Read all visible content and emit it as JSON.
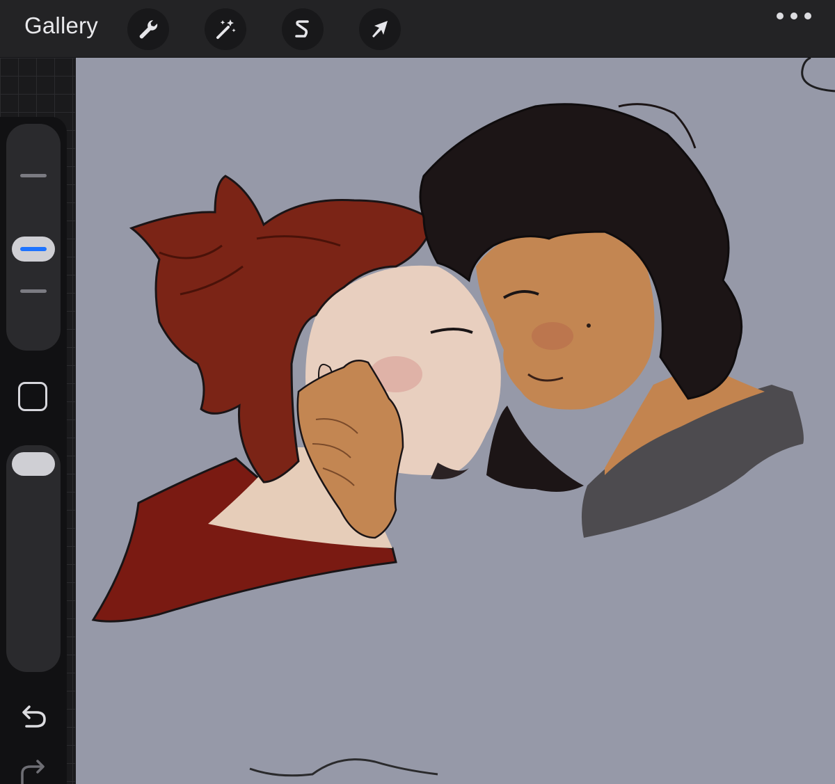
{
  "toolbar": {
    "gallery_label": "Gallery",
    "tools": [
      {
        "name": "wrench-icon",
        "role": "actions"
      },
      {
        "name": "magic-wand-icon",
        "role": "adjustments"
      },
      {
        "name": "selection-s-icon",
        "role": "selection"
      },
      {
        "name": "arrow-cursor-icon",
        "role": "transform"
      }
    ],
    "more_icon": "ellipsis-icon"
  },
  "sidebar": {
    "brush_size_icon": "brush-size-slider",
    "modify_icon": "square-icon",
    "opacity_icon": "opacity-slider",
    "undo_icon": "undo-icon",
    "redo_icon": "redo-icon",
    "accent_color": "#1e73ff"
  },
  "canvas": {
    "background_color": "#9699a8",
    "artwork": "illustration-two-figures"
  }
}
